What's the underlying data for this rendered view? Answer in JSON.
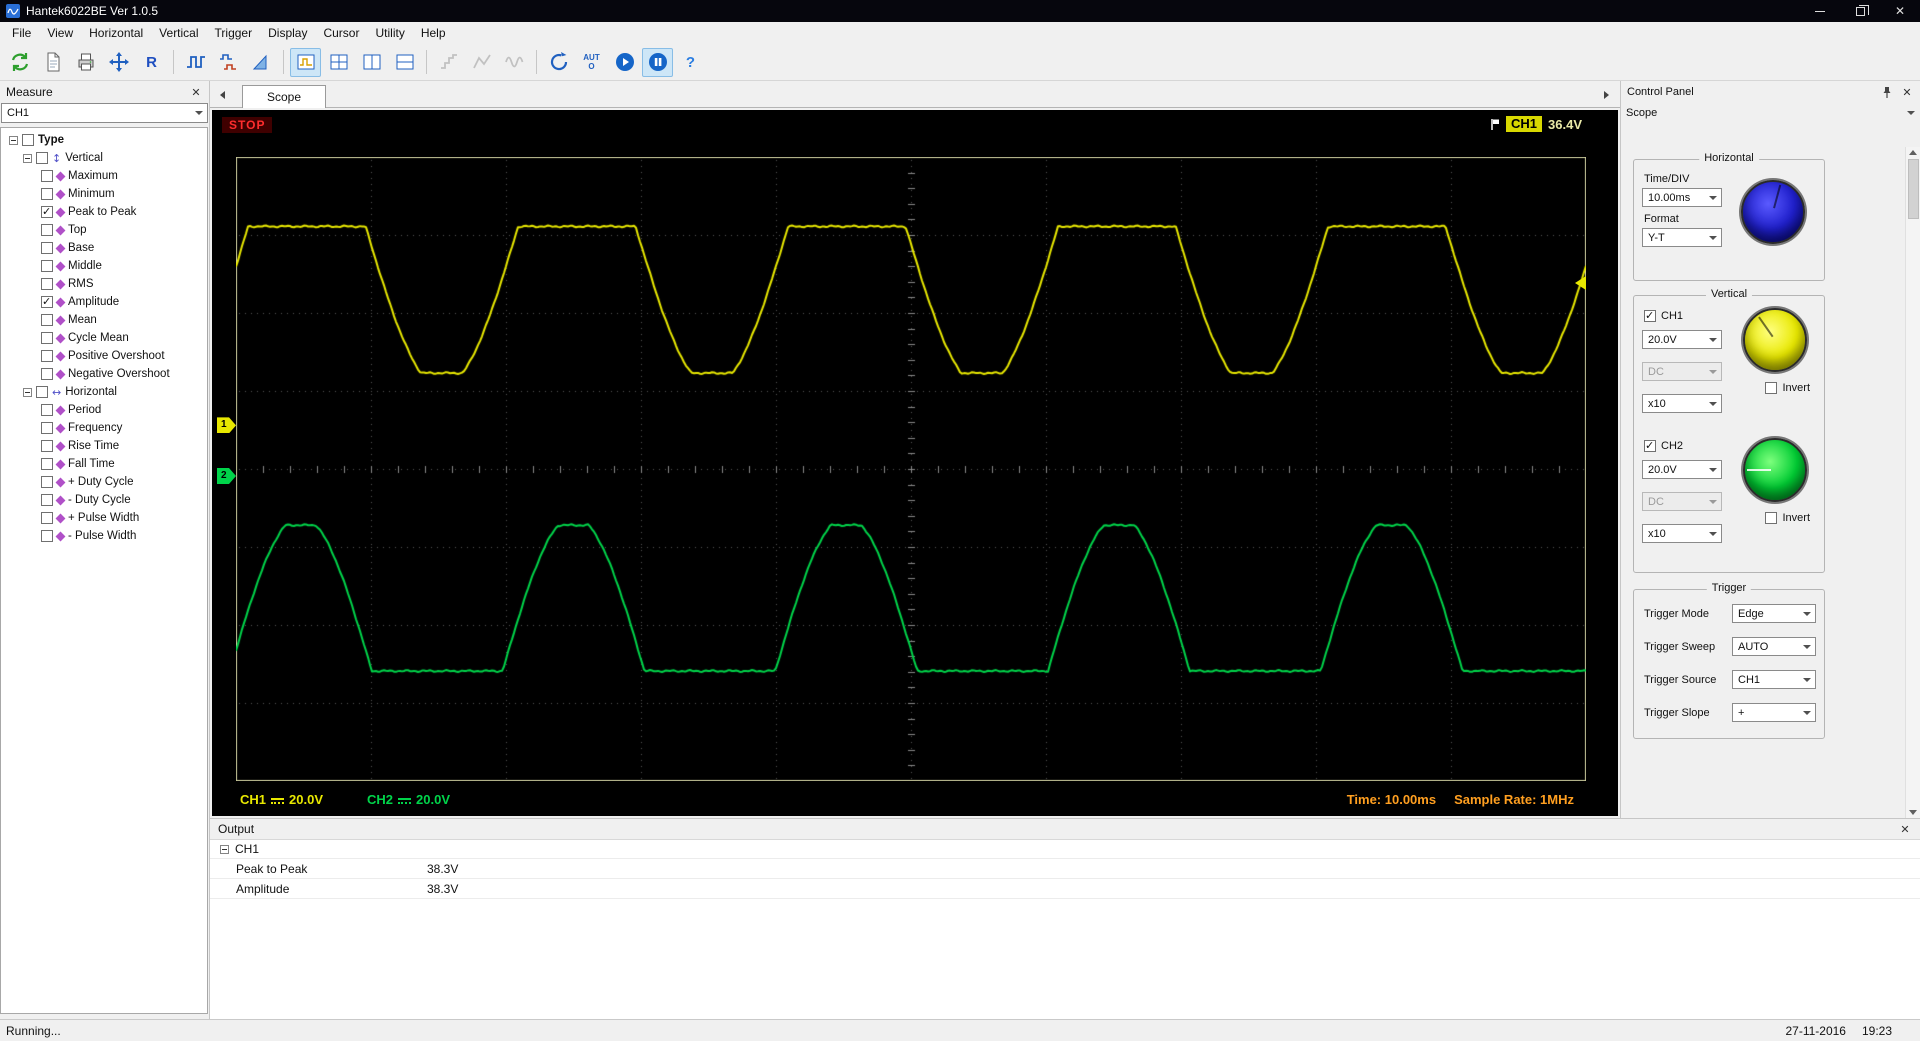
{
  "window": {
    "title": "Hantek6022BE Ver 1.0.5"
  },
  "menu": {
    "items": [
      "File",
      "View",
      "Horizontal",
      "Vertical",
      "Trigger",
      "Display",
      "Cursor",
      "Utility",
      "Help"
    ]
  },
  "toolbar": {
    "reference_label": "R",
    "auto_label": "AUTO"
  },
  "measure": {
    "title": "Measure",
    "channel": "CH1",
    "root_label": "Type",
    "groups": [
      {
        "label": "Vertical",
        "items": [
          {
            "label": "Maximum",
            "checked": false
          },
          {
            "label": "Minimum",
            "checked": false
          },
          {
            "label": "Peak to Peak",
            "checked": true
          },
          {
            "label": "Top",
            "checked": false
          },
          {
            "label": "Base",
            "checked": false
          },
          {
            "label": "Middle",
            "checked": false
          },
          {
            "label": "RMS",
            "checked": false
          },
          {
            "label": "Amplitude",
            "checked": true
          },
          {
            "label": "Mean",
            "checked": false
          },
          {
            "label": "Cycle Mean",
            "checked": false
          },
          {
            "label": "Positive Overshoot",
            "checked": false
          },
          {
            "label": "Negative Overshoot",
            "checked": false
          }
        ]
      },
      {
        "label": "Horizontal",
        "items": [
          {
            "label": "Period",
            "checked": false
          },
          {
            "label": "Frequency",
            "checked": false
          },
          {
            "label": "Rise Time",
            "checked": false
          },
          {
            "label": "Fall Time",
            "checked": false
          },
          {
            "label": "+ Duty Cycle",
            "checked": false
          },
          {
            "label": "- Duty Cycle",
            "checked": false
          },
          {
            "label": "+ Pulse Width",
            "checked": false
          },
          {
            "label": "- Pulse Width",
            "checked": false
          }
        ]
      }
    ]
  },
  "tabs": {
    "active": "Scope"
  },
  "scope": {
    "run_state": "STOP",
    "trigger_channel": "CH1",
    "trigger_level_text": "36.4V",
    "markers": {
      "ch1": "1",
      "ch2": "2"
    },
    "bottom": {
      "ch1": "CH1",
      "ch1_volts": "20.0V",
      "ch2": "CH2",
      "ch2_volts": "20.0V",
      "time": "Time: 10.00ms",
      "sample_rate": "Sample Rate: 1MHz"
    },
    "grid": {
      "cols": 10,
      "rows": 8
    },
    "chart_data": {
      "type": "line",
      "x_units": "divisions (10.00ms/div)",
      "y_units": "divisions (20.0V/div)",
      "trigger_level_div": 2.38,
      "series": [
        {
          "name": "CH1",
          "color": "#e8e800",
          "shape": "top-clipped-sine",
          "period_div": 2.0,
          "phase_div": 0.09,
          "flat_frac": 0.435,
          "top_div": 3.11,
          "bottom_div": 1.23,
          "zero_marker_div": 0.56
        },
        {
          "name": "CH2",
          "color": "#00d44a",
          "shape": "bottom-clipped-sine",
          "period_div": 2.02,
          "phase_div": 1.975,
          "hump_frac": 0.52,
          "top_div": -0.72,
          "bottom_div": -2.59,
          "zero_marker_div": -0.09
        }
      ]
    }
  },
  "control_panel": {
    "title": "Control Panel",
    "view_selector": "Scope",
    "horizontal": {
      "title": "Horizontal",
      "time_div_label": "Time/DIV",
      "time_div_value": "10.00ms",
      "format_label": "Format",
      "format_value": "Y-T"
    },
    "vertical": {
      "title": "Vertical",
      "ch1": {
        "label": "CH1",
        "enabled": true,
        "volts": "20.0V",
        "coupling": "DC",
        "probe": "x10",
        "invert_label": "Invert",
        "invert": false
      },
      "ch2": {
        "label": "CH2",
        "enabled": true,
        "volts": "20.0V",
        "coupling": "DC",
        "probe": "x10",
        "invert_label": "Invert",
        "invert": false
      }
    },
    "trigger": {
      "title": "Trigger",
      "rows": [
        {
          "label": "Trigger Mode",
          "value": "Edge"
        },
        {
          "label": "Trigger Sweep",
          "value": "AUTO"
        },
        {
          "label": "Trigger Source",
          "value": "CH1"
        },
        {
          "label": "Trigger Slope",
          "value": "+"
        }
      ]
    }
  },
  "output": {
    "title": "Output",
    "group": "CH1",
    "rows": [
      {
        "label": "Peak to Peak",
        "value": "38.3V"
      },
      {
        "label": "Amplitude",
        "value": "38.3V"
      }
    ]
  },
  "status_bar": {
    "left": "Running...",
    "date": "27-11-2016",
    "time": "19:23"
  }
}
